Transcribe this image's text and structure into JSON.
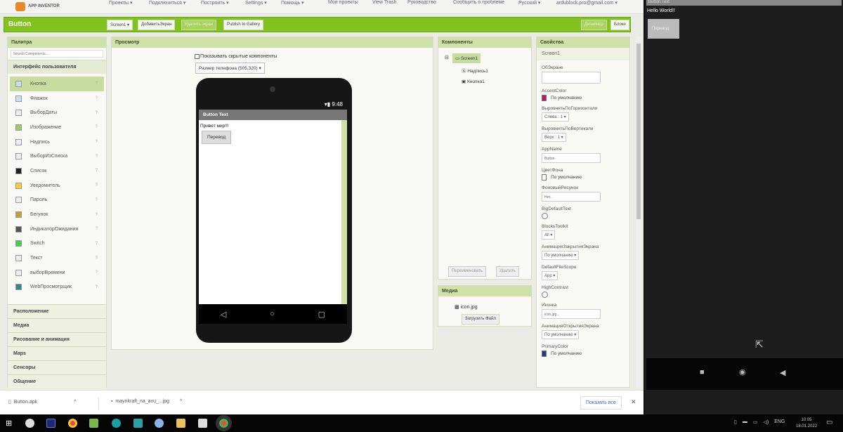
{
  "nav": {
    "logo": "APP INVENTOR",
    "menus": [
      "Проекты ▾",
      "Подключиться ▾",
      "Построить ▾",
      "Settings ▾",
      "Помощь ▾"
    ],
    "links": [
      "Мои проекты",
      "View Trash",
      "Руководство",
      "Сообщить о проблеме",
      "Русский ▾",
      "ardublock.pro@gmail.com ▾"
    ]
  },
  "toolbar": {
    "title": "Button",
    "screen": "Screen1 ▾",
    "add_screen": "ДобавитьЭкран",
    "remove_screen": "Удалить экран",
    "publish": "Publish to Gallery",
    "designer": "Дизайнер",
    "blocks": "Блоки"
  },
  "palette": {
    "title": "Палитра",
    "search_placeholder": "Search Components...",
    "section": "Интерфейс пользователя",
    "items": [
      "Кнопка",
      "Флажок",
      "ВыборДаты",
      "Изображение",
      "Надпись",
      "ВыборИзСписка",
      "Список",
      "Уведомитель",
      "Пароль",
      "Бегунок",
      "ИндикаторОжидания",
      "Switch",
      "Текст",
      "выборВремени",
      "WebПросмотрщик"
    ],
    "categories": [
      "Расположение",
      "Медиа",
      "Рисование и анимация",
      "Maps",
      "Сенсоры",
      "Общение"
    ]
  },
  "viewer": {
    "title": "Просмотр",
    "show_hidden": "Показывать скрытые компоненты",
    "size": "Размер телефона (505,320) ▾",
    "time": "9:48",
    "screen_title": "Button Text",
    "label_text": "Привет мир!!!",
    "button_text": "Перевод"
  },
  "components": {
    "title": "Компоненты",
    "tree": [
      "Screen1",
      "Надпись1",
      "Кнопка1"
    ],
    "rename": "Переименовать",
    "delete": "Удалить"
  },
  "media": {
    "title": "Медиа",
    "file": "icon.jpg",
    "upload": "Загрузить Файл"
  },
  "properties": {
    "title": "Свойства",
    "component": "Screen1",
    "items": [
      {
        "label": "ОбЭкране",
        "type": "textarea",
        "value": ""
      },
      {
        "label": "AccentColor",
        "type": "color",
        "value": "По умолчанию",
        "color": "#c2185b"
      },
      {
        "label": "ВыровнятьПоГоризонтали",
        "type": "select",
        "value": "Слева : 1 ▾"
      },
      {
        "label": "ВыровнятьПоВертикали",
        "type": "select",
        "value": "Верх : 1 ▾"
      },
      {
        "label": "AppName",
        "type": "input",
        "value": "Button"
      },
      {
        "label": "ЦветФона",
        "type": "color",
        "value": "По умолчанию",
        "color": "#ffffff"
      },
      {
        "label": "ФоновыйРисунок",
        "type": "input",
        "value": "Нет..."
      },
      {
        "label": "BigDefaultText",
        "type": "check",
        "value": ""
      },
      {
        "label": "BlocksToolkit",
        "type": "select",
        "value": "All ▾"
      },
      {
        "label": "АнимацияЗакрытияЭкрана",
        "type": "select",
        "value": "По умолчанию ▾"
      },
      {
        "label": "DefaultFileScope",
        "type": "select",
        "value": "App ▾"
      },
      {
        "label": "HighContrast",
        "type": "check",
        "value": ""
      },
      {
        "label": "Иконка",
        "type": "input",
        "value": "icon.jpg..."
      },
      {
        "label": "АнимацияОткрытияЭкрана",
        "type": "select",
        "value": "По умолчанию ▾"
      },
      {
        "label": "PrimaryColor",
        "type": "color",
        "value": "По умолчанию",
        "color": "#283593"
      }
    ]
  },
  "downloads": {
    "files": [
      "Button.apk",
      "maynkraft_na_avu_...jpg"
    ],
    "show_all": "Показать все",
    "close": "✕"
  },
  "emulator": {
    "title": "Button Text",
    "label": "Hello World!!",
    "button": "Перевод"
  },
  "taskbar": {
    "lang": "ENG",
    "time": "10:05",
    "date": "18.01.2022"
  }
}
